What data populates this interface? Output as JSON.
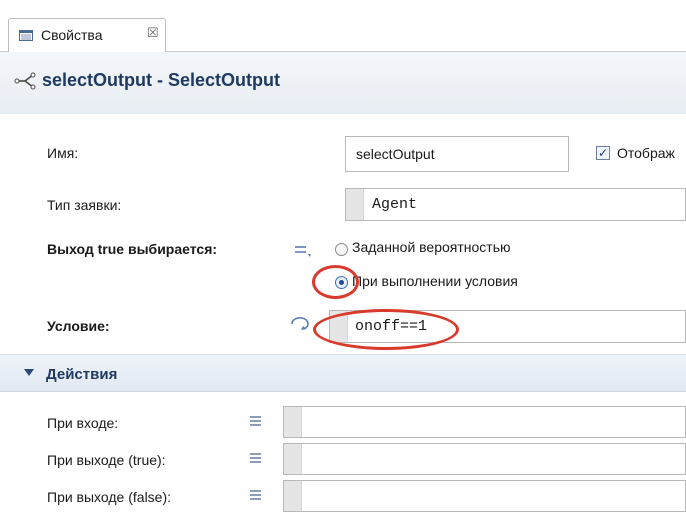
{
  "tab": {
    "title": "Свойства",
    "close_glyph": "☒",
    "icon": "properties-icon"
  },
  "header": {
    "title": "selectOutput - SelectOutput",
    "icon": "select-output-icon",
    "title_color": "#1f3a60"
  },
  "fields": {
    "name": {
      "label": "Имя:",
      "value": "selectOutput"
    },
    "show_name": {
      "label": "Отображ",
      "checked": true
    },
    "agent_type": {
      "label": "Тип заявки:",
      "value": "Agent"
    },
    "select_true": {
      "label": "Выход true выбирается:",
      "options": [
        "Заданной вероятностью",
        "При выполнении условия"
      ],
      "selected_index": 1
    },
    "condition": {
      "label": "Условие:",
      "value": "onoff==1"
    }
  },
  "section": {
    "title": "Действия",
    "items": [
      {
        "label": "При входе:",
        "value": ""
      },
      {
        "label": "При выходе (true):",
        "value": ""
      },
      {
        "label": "При выходе (false):",
        "value": ""
      }
    ]
  },
  "colors": {
    "annotation": "#d83a2b",
    "header_text": "#1f3a60"
  }
}
